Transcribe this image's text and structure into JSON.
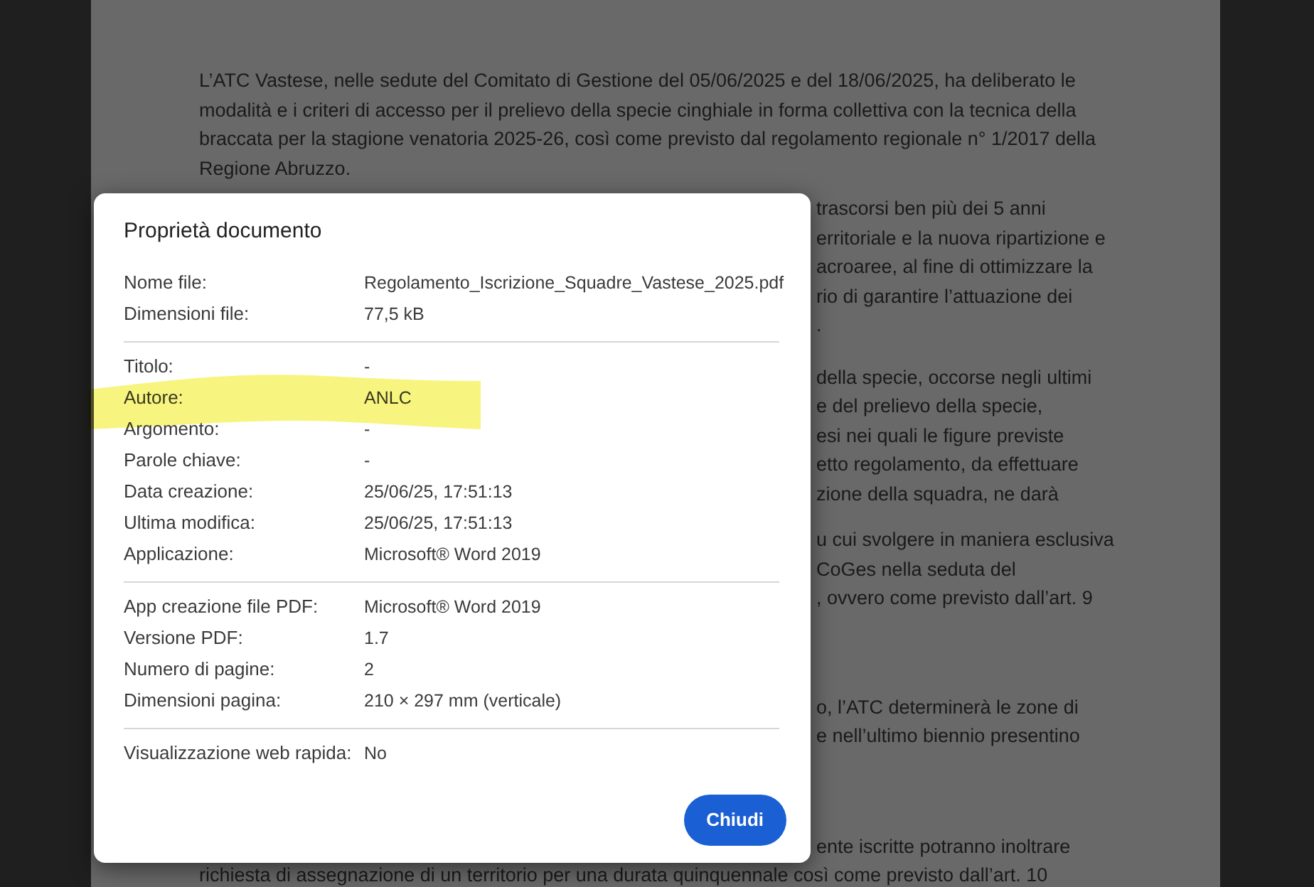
{
  "document_page": {
    "paragraphs": [
      {
        "lines": [
          {
            "kind": "full",
            "text": "L’ATC Vastese, nelle sedute del Comitato di Gestione del 05/06/2025 e del 18/06/2025, ha deliberato le"
          },
          {
            "kind": "full",
            "text": "modalità e i criteri di accesso per il prelievo della specie cinghiale in forma collettiva con la tecnica della"
          },
          {
            "kind": "full",
            "text": "braccata per la stagione venatoria 2025-26, così come previsto dal regolamento regionale n° 1/2017 della"
          },
          {
            "kind": "full",
            "text": "Regione Abruzzo."
          }
        ]
      },
      {
        "lines": [
          {
            "kind": "partial",
            "text": "trascorsi ben più dei 5 anni"
          },
          {
            "kind": "partial",
            "text": "erritoriale e la nuova ripartizione e"
          },
          {
            "kind": "partial",
            "text": "acroaree, al fine di ottimizzare la"
          },
          {
            "kind": "partial",
            "text": "rio di garantire l’attuazione dei"
          },
          {
            "kind": "partial",
            "text": "."
          }
        ]
      },
      {
        "lines": [
          {
            "kind": "partial",
            "text": "della specie, occorse negli ultimi"
          },
          {
            "kind": "partial",
            "text": "e del prelievo della specie,"
          },
          {
            "kind": "partial",
            "text": "esi nei quali le figure previste"
          },
          {
            "kind": "partial",
            "text": "etto regolamento, da effettuare"
          },
          {
            "kind": "partial",
            "text": "zione della squadra, ne darà"
          }
        ]
      },
      {
        "lines": [
          {
            "kind": "partial",
            "text": "u cui svolgere in maniera esclusiva"
          },
          {
            "kind": "partial",
            "text": "CoGes nella seduta del"
          },
          {
            "kind": "partial",
            "text": ", ovvero come previsto dall’art. 9"
          }
        ]
      },
      {
        "lines": [
          {
            "kind": "partial",
            "text": "o, l’ATC determinerà le zone di"
          },
          {
            "kind": "partial",
            "text": "e nell’ultimo biennio presentino"
          }
        ]
      },
      {
        "lines": [
          {
            "kind": "partial",
            "text": "ente iscritte potranno inoltrare"
          },
          {
            "kind": "full",
            "text": "richiesta di assegnazione di un territorio per una durata quinquennale così come previsto dall’art. 10"
          }
        ]
      }
    ]
  },
  "dialog": {
    "title": "Proprietà documento",
    "sections": [
      {
        "rows": [
          {
            "label": "Nome file:",
            "value": "Regolamento_Iscrizione_Squadre_Vastese_2025.pdf"
          },
          {
            "label": "Dimensioni file:",
            "value": "77,5 kB"
          }
        ]
      },
      {
        "rows": [
          {
            "label": "Titolo:",
            "value": "-"
          },
          {
            "label": "Autore:",
            "value": "ANLC"
          },
          {
            "label": "Argomento:",
            "value": "-"
          },
          {
            "label": "Parole chiave:",
            "value": "-"
          },
          {
            "label": "Data creazione:",
            "value": "25/06/25, 17:51:13"
          },
          {
            "label": "Ultima modifica:",
            "value": "25/06/25, 17:51:13"
          },
          {
            "label": "Applicazione:",
            "value": "Microsoft® Word 2019"
          }
        ]
      },
      {
        "rows": [
          {
            "label": "App creazione file PDF:",
            "value": "Microsoft® Word 2019"
          },
          {
            "label": "Versione PDF:",
            "value": "1.7"
          },
          {
            "label": "Numero di pagine:",
            "value": "2"
          },
          {
            "label": "Dimensioni pagina:",
            "value": "210 × 297 mm (verticale)"
          }
        ]
      },
      {
        "rows": [
          {
            "label": "Visualizzazione web rapida:",
            "value": "No"
          }
        ]
      }
    ],
    "buttons": [
      "Chiudi"
    ]
  }
}
